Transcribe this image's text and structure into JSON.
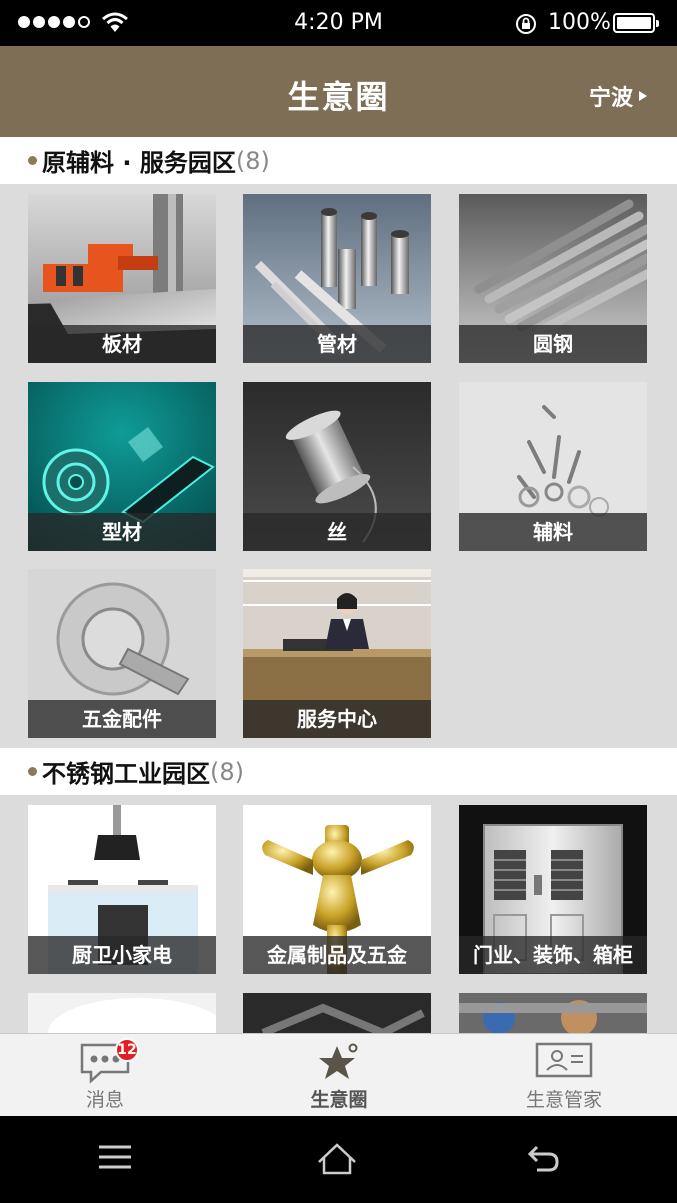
{
  "status_bar": {
    "time": "4:20 PM",
    "battery": "100%",
    "icons": [
      "signal-dots",
      "wifi-icon",
      "rotation-lock-icon",
      "battery-icon"
    ]
  },
  "nav": {
    "title": "生意圈",
    "city": "宁波"
  },
  "sections": [
    {
      "title": "原辅料 · 服务园区",
      "count": "(8)",
      "tiles": [
        {
          "label": "板材"
        },
        {
          "label": "管材"
        },
        {
          "label": "圆钢"
        },
        {
          "label": "型材"
        },
        {
          "label": "丝"
        },
        {
          "label": "辅料"
        },
        {
          "label": "五金配件"
        },
        {
          "label": "服务中心",
          "watermark": "服务中心"
        }
      ]
    },
    {
      "title": "不锈钢工业园区",
      "count": "(8)",
      "tiles": [
        {
          "label": "厨卫小家电"
        },
        {
          "label": "金属制品及五金"
        },
        {
          "label": "门业、装饰、箱柜"
        }
      ]
    }
  ],
  "tabbar": {
    "tabs": [
      {
        "label": "消息",
        "badge": "12",
        "icon": "chat-bubble-icon"
      },
      {
        "label": "生意圈",
        "icon": "star-icon",
        "active": true
      },
      {
        "label": "生意管家",
        "icon": "id-card-icon"
      }
    ]
  },
  "system_nav": {
    "buttons": [
      "menu-icon",
      "home-icon",
      "back-icon"
    ]
  },
  "colors": {
    "nav_bg": "#7d6e55",
    "content_bg": "#dcdcdc",
    "badge": "#e51c23"
  }
}
